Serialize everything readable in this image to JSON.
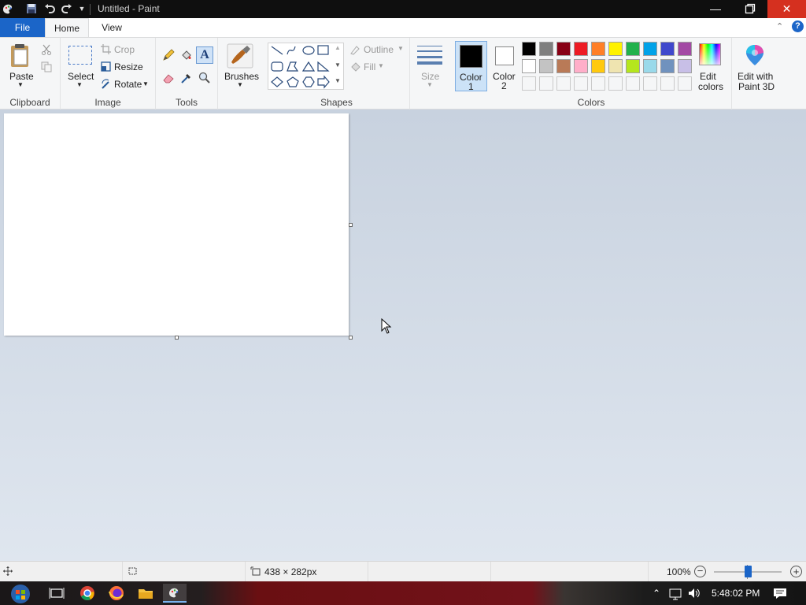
{
  "window": {
    "title": "Untitled - Paint"
  },
  "tabs": [
    {
      "label": "File"
    },
    {
      "label": "Home"
    },
    {
      "label": "View"
    }
  ],
  "ribbon": {
    "clipboard": {
      "paste": "Paste",
      "group": "Clipboard"
    },
    "image": {
      "select": "Select",
      "crop": "Crop",
      "resize": "Resize",
      "rotate": "Rotate",
      "group": "Image"
    },
    "tools": {
      "group": "Tools"
    },
    "brushes": {
      "label": "Brushes"
    },
    "shapes": {
      "outline": "Outline",
      "fill": "Fill",
      "group": "Shapes"
    },
    "size": {
      "label": "Size"
    },
    "colors": {
      "color1_line1": "Color",
      "color1_line2": "1",
      "color2_line1": "Color",
      "color2_line2": "2",
      "edit_line1": "Edit",
      "edit_line2": "colors",
      "paint3d_line1": "Edit with",
      "paint3d_line2": "Paint 3D",
      "group": "Colors",
      "color1": "#000000",
      "color2": "#ffffff",
      "palette_row1": [
        "#000000",
        "#7f7f7f",
        "#880015",
        "#ed1c24",
        "#ff7f27",
        "#fff200",
        "#22b14c",
        "#00a2e8",
        "#3f48cc",
        "#a349a4"
      ],
      "palette_row2": [
        "#ffffff",
        "#c3c3c3",
        "#b97a57",
        "#ffaec9",
        "#ffc90e",
        "#efe4b0",
        "#b5e61d",
        "#99d9ea",
        "#7092be",
        "#c8bfe7"
      ]
    }
  },
  "status": {
    "size": "438 × 282px",
    "zoom": "100%"
  },
  "taskbar": {
    "time": "5:48:02 PM"
  }
}
